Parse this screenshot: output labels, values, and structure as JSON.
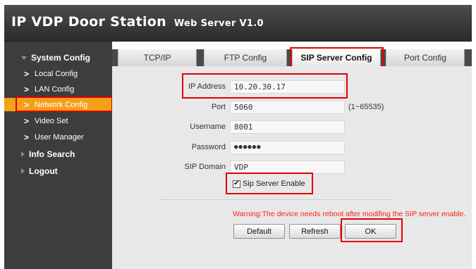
{
  "header": {
    "title": "IP VDP Door Station",
    "subtitle": "Web Server V1.0"
  },
  "sidebar": {
    "groups": [
      {
        "label": "System Config",
        "expanded": true
      },
      {
        "label": "Info Search",
        "expanded": false
      },
      {
        "label": "Logout",
        "expanded": false
      }
    ],
    "items": [
      {
        "label": "Local Config",
        "active": false
      },
      {
        "label": "LAN Config",
        "active": false
      },
      {
        "label": "Network Config",
        "active": true
      },
      {
        "label": "Video Set",
        "active": false
      },
      {
        "label": "User Manager",
        "active": false
      }
    ]
  },
  "tabs": [
    {
      "label": "TCP/IP",
      "active": false
    },
    {
      "label": "FTP Config",
      "active": false
    },
    {
      "label": "SIP Server Config",
      "active": true
    },
    {
      "label": "Port Config",
      "active": false
    }
  ],
  "form": {
    "ip_label": "IP Address",
    "ip_value": "10.20.30.17",
    "port_label": "Port",
    "port_value": "5060",
    "port_range": "(1~65535)",
    "username_label": "Username",
    "username_value": "8001",
    "password_label": "Password",
    "password_value": "●●●●●●",
    "domain_label": "SIP Domain",
    "domain_value": "VDP",
    "sip_enable_label": "Sip Server Enable",
    "sip_enable_checked": true,
    "checkmark": "✔"
  },
  "warning": "Warning:The device needs reboot after modifing the SIP server enable.",
  "buttons": {
    "default_label": "Default",
    "refresh_label": "Refresh",
    "ok_label": "OK"
  },
  "colors": {
    "highlight_border": "#e00000",
    "active_item": "#f5a01a",
    "warning_text": "#ff1a1a"
  }
}
